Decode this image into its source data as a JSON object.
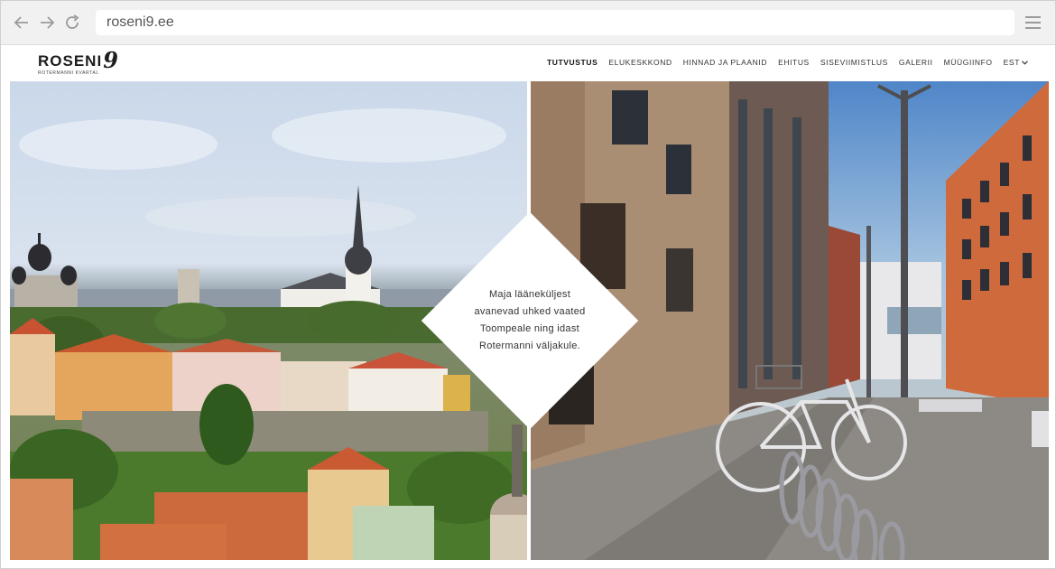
{
  "browser": {
    "url": "roseni9.ee",
    "icons": [
      "back-arrow-icon",
      "forward-arrow-icon",
      "reload-icon",
      "hamburger-menu-icon"
    ]
  },
  "site": {
    "logo_text": "ROSENI",
    "logo_digit": "9",
    "logo_subtitle": "Rotermanni kvartal",
    "nav": [
      {
        "label": "TUTVUSTUS",
        "active": true
      },
      {
        "label": "ELUKESKKOND",
        "active": false
      },
      {
        "label": "HINNAD JA PLAANID",
        "active": false
      },
      {
        "label": "EHITUS",
        "active": false
      },
      {
        "label": "SISEVIIMISTLUS",
        "active": false
      },
      {
        "label": "GALERII",
        "active": false
      },
      {
        "label": "MÜÜGIINFO",
        "active": false
      }
    ],
    "language": "EST"
  },
  "hero": {
    "caption_lines": [
      "Maja lääneküljest",
      "avanevad uhked vaated",
      "Toompeale ning idast",
      "Rotermanni väljakule."
    ]
  },
  "colors": {
    "chrome_bg": "#f1f1f1",
    "text_dark": "#1d1d1d",
    "brick": "#c8592f",
    "sky": "#4f86c8"
  }
}
